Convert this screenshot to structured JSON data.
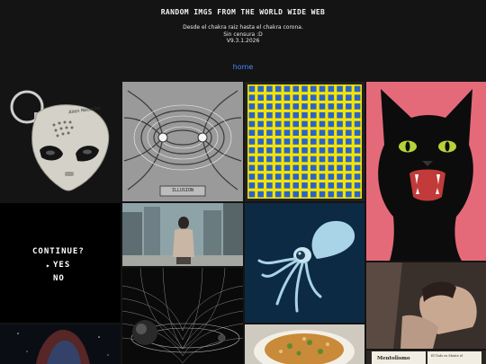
{
  "header": {
    "title": "RANDOM IMGS FROM THE WORLD WIDE WEB",
    "tagline_line1": "Desde el chakra raiz hasta el chakra corona.",
    "tagline_line2": "Sin censura :D",
    "version": "V9.3.1.2026"
  },
  "nav": {
    "home_label": "home"
  },
  "tiles": {
    "alien": {
      "label": "Alien Recorder"
    },
    "illusion": {
      "label": "ILLUSION"
    },
    "game": {
      "prompt": "CONTINUE?",
      "yes": "YES",
      "no": "NO"
    },
    "book": {
      "title_left": "Mentolismo",
      "title_right": "El Todo es Mente el"
    }
  },
  "colors": {
    "background": "#141414",
    "link": "#4a86ff",
    "cat_bg": "#e46a7a",
    "checker_yellow": "#f3e400",
    "checker_blue": "#2b63c9"
  }
}
